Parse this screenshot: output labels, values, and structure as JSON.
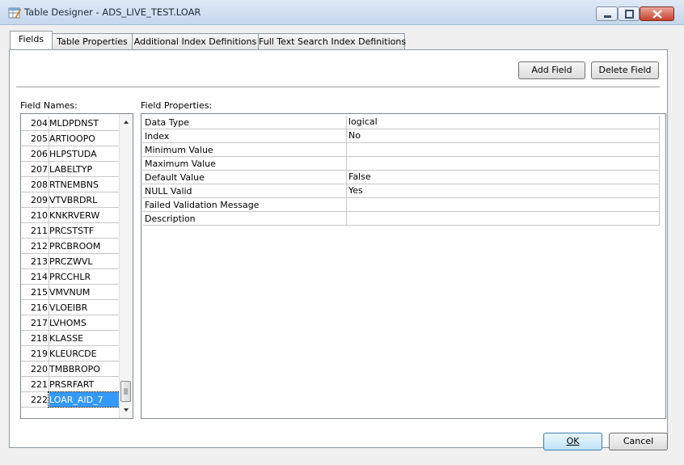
{
  "window": {
    "title": "Table Designer - ADS_LIVE_TEST.LOAR"
  },
  "tabs": [
    "Fields",
    "Table Properties",
    "Additional Index Definitions",
    "Full Text Search Index Definitions"
  ],
  "toolbar": {
    "add_field": "Add Field",
    "delete_field": "Delete Field"
  },
  "field_names_label": "Field Names:",
  "field_properties_label": "Field Properties:",
  "fields": [
    {
      "num": "204",
      "name": "MLDPDNST"
    },
    {
      "num": "205",
      "name": "ARTIOOPO"
    },
    {
      "num": "206",
      "name": "HLPSTUDA"
    },
    {
      "num": "207",
      "name": "LABELTYP"
    },
    {
      "num": "208",
      "name": "RTNEMBNS"
    },
    {
      "num": "209",
      "name": "VTVBRDRL"
    },
    {
      "num": "210",
      "name": "KNKRVERW"
    },
    {
      "num": "211",
      "name": "PRCSTSTF"
    },
    {
      "num": "212",
      "name": "PRCBROOM"
    },
    {
      "num": "213",
      "name": "PRCZWVL"
    },
    {
      "num": "214",
      "name": "PRCCHLR"
    },
    {
      "num": "215",
      "name": "VMVNUM"
    },
    {
      "num": "216",
      "name": "VLOEIBR"
    },
    {
      "num": "217",
      "name": "LVHOMS"
    },
    {
      "num": "218",
      "name": "KLASSE"
    },
    {
      "num": "219",
      "name": "KLEURCDE"
    },
    {
      "num": "220",
      "name": "TMBBROPO"
    },
    {
      "num": "221",
      "name": "PRSRFART"
    },
    {
      "num": "222",
      "name": "LOAR_AID_7"
    }
  ],
  "selected_field_index": 18,
  "properties": [
    {
      "name": "Data Type",
      "value": "logical"
    },
    {
      "name": "Index",
      "value": "No"
    },
    {
      "name": "Minimum Value",
      "value": ""
    },
    {
      "name": "Maximum Value",
      "value": ""
    },
    {
      "name": "Default Value",
      "value": "False"
    },
    {
      "name": "NULL Valid",
      "value": "Yes"
    },
    {
      "name": "Failed Validation Message",
      "value": ""
    },
    {
      "name": "Description",
      "value": ""
    }
  ],
  "dialog": {
    "ok": "OK",
    "cancel": "Cancel"
  },
  "colors": {
    "selection": "#3399ff",
    "title_gradient_top": "#dfe9f5",
    "close_button": "#c7402e"
  },
  "icons": [
    "table-designer-app-icon",
    "minimize-icon",
    "maximize-icon",
    "close-icon",
    "scroll-up-arrow-icon",
    "scroll-down-arrow-icon",
    "scroll-thumb-grip-icon"
  ]
}
